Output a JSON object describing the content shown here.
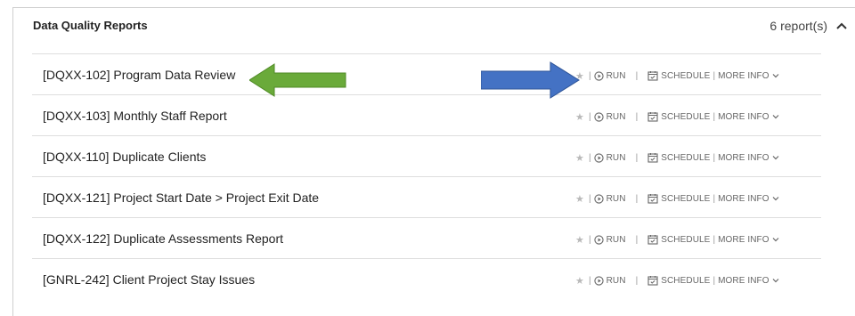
{
  "panel": {
    "title": "Data Quality Reports",
    "count": "6 report(s)"
  },
  "actions": {
    "run": "RUN",
    "schedule": "SCHEDULE",
    "more_info": "MORE INFO",
    "separator": "|"
  },
  "reports": [
    {
      "title": "[DQXX-102] Program Data Review"
    },
    {
      "title": "[DQXX-103] Monthly Staff Report"
    },
    {
      "title": "[DQXX-110] Duplicate Clients"
    },
    {
      "title": "[DQXX-121] Project Start Date > Project Exit Date"
    },
    {
      "title": "[DQXX-122] Duplicate Assessments Report"
    },
    {
      "title": "[GNRL-242] Client Project Stay Issues"
    }
  ],
  "annotations": {
    "green_arrow_color": "#6aaa3a",
    "blue_arrow_color": "#4472c4",
    "icons": [
      "star-icon",
      "play-circle-icon",
      "calendar-icon",
      "chevron-down-icon",
      "chevron-up-icon"
    ]
  }
}
